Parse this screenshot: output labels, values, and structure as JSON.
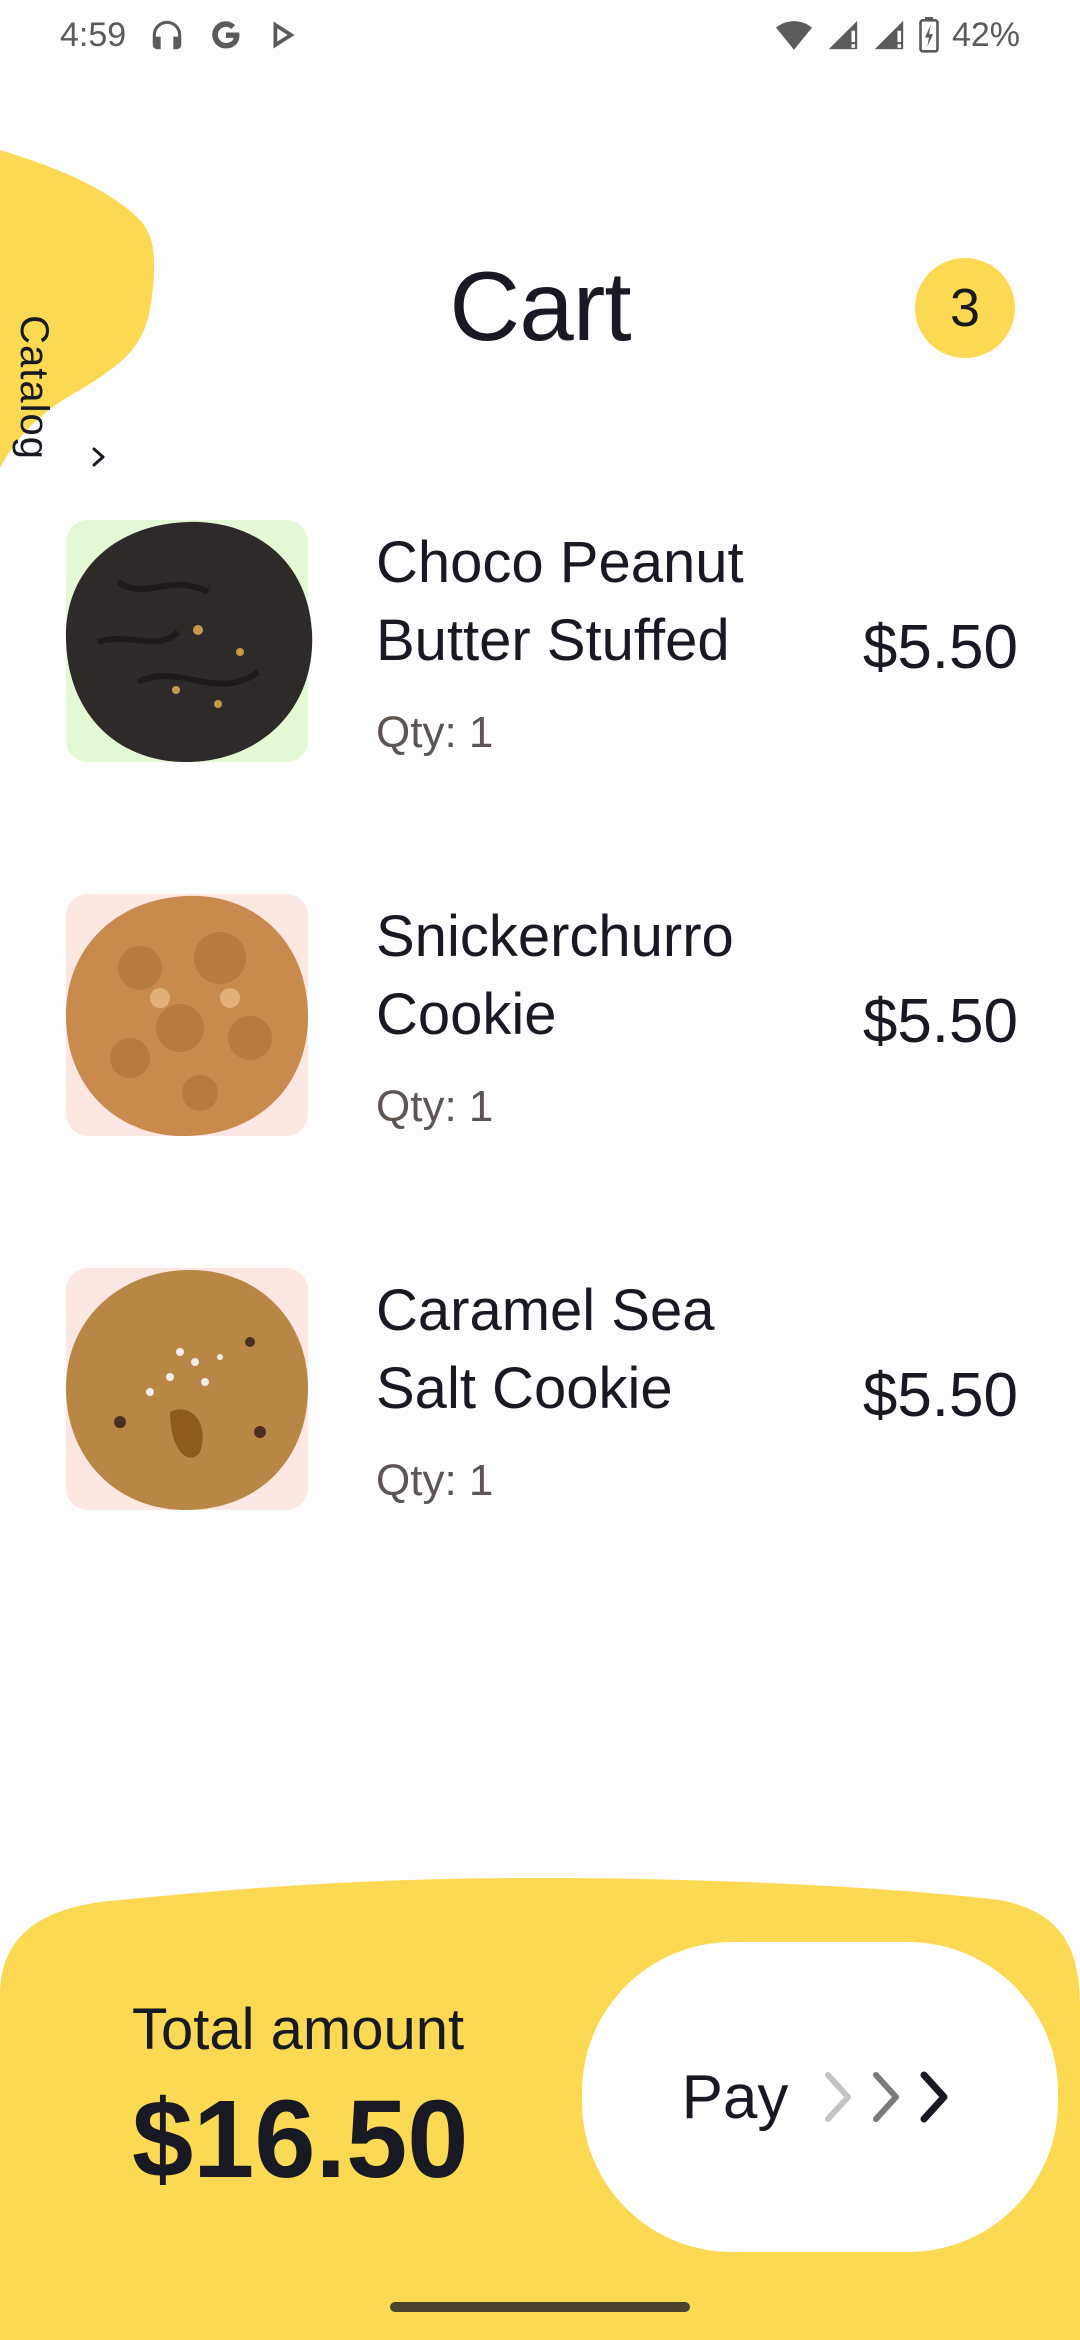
{
  "status_bar": {
    "time": "4:59",
    "battery": "42%",
    "icons_left": [
      "headphones-icon",
      "google-icon",
      "play-store-icon"
    ],
    "icons_right": [
      "wifi-icon",
      "signal-icon",
      "signal-icon",
      "battery-charging-icon"
    ]
  },
  "catalog_tab": {
    "label": "Catalog",
    "icon": "chevron-right-icon"
  },
  "header": {
    "title": "Cart",
    "badge_count": "3"
  },
  "items": [
    {
      "name": "Choco Peanut Butter Stuffed",
      "qty": "Qty: 1",
      "price": "$5.50",
      "bg": "#E4F8D6",
      "cookie": "#2E2A2A"
    },
    {
      "name": "Snickerchurro Cookie",
      "qty": "Qty: 1",
      "price": "$5.50",
      "bg": "#FDE7E3",
      "cookie": "#C98A4E"
    },
    {
      "name": "Caramel Sea Salt Cookie",
      "qty": "Qty: 1",
      "price": "$5.50",
      "bg": "#FDE7E3",
      "cookie": "#B88645"
    }
  ],
  "footer": {
    "total_label": "Total amount",
    "total_value": "$16.50",
    "pay_label": "Pay",
    "accent": "#FCD953"
  }
}
